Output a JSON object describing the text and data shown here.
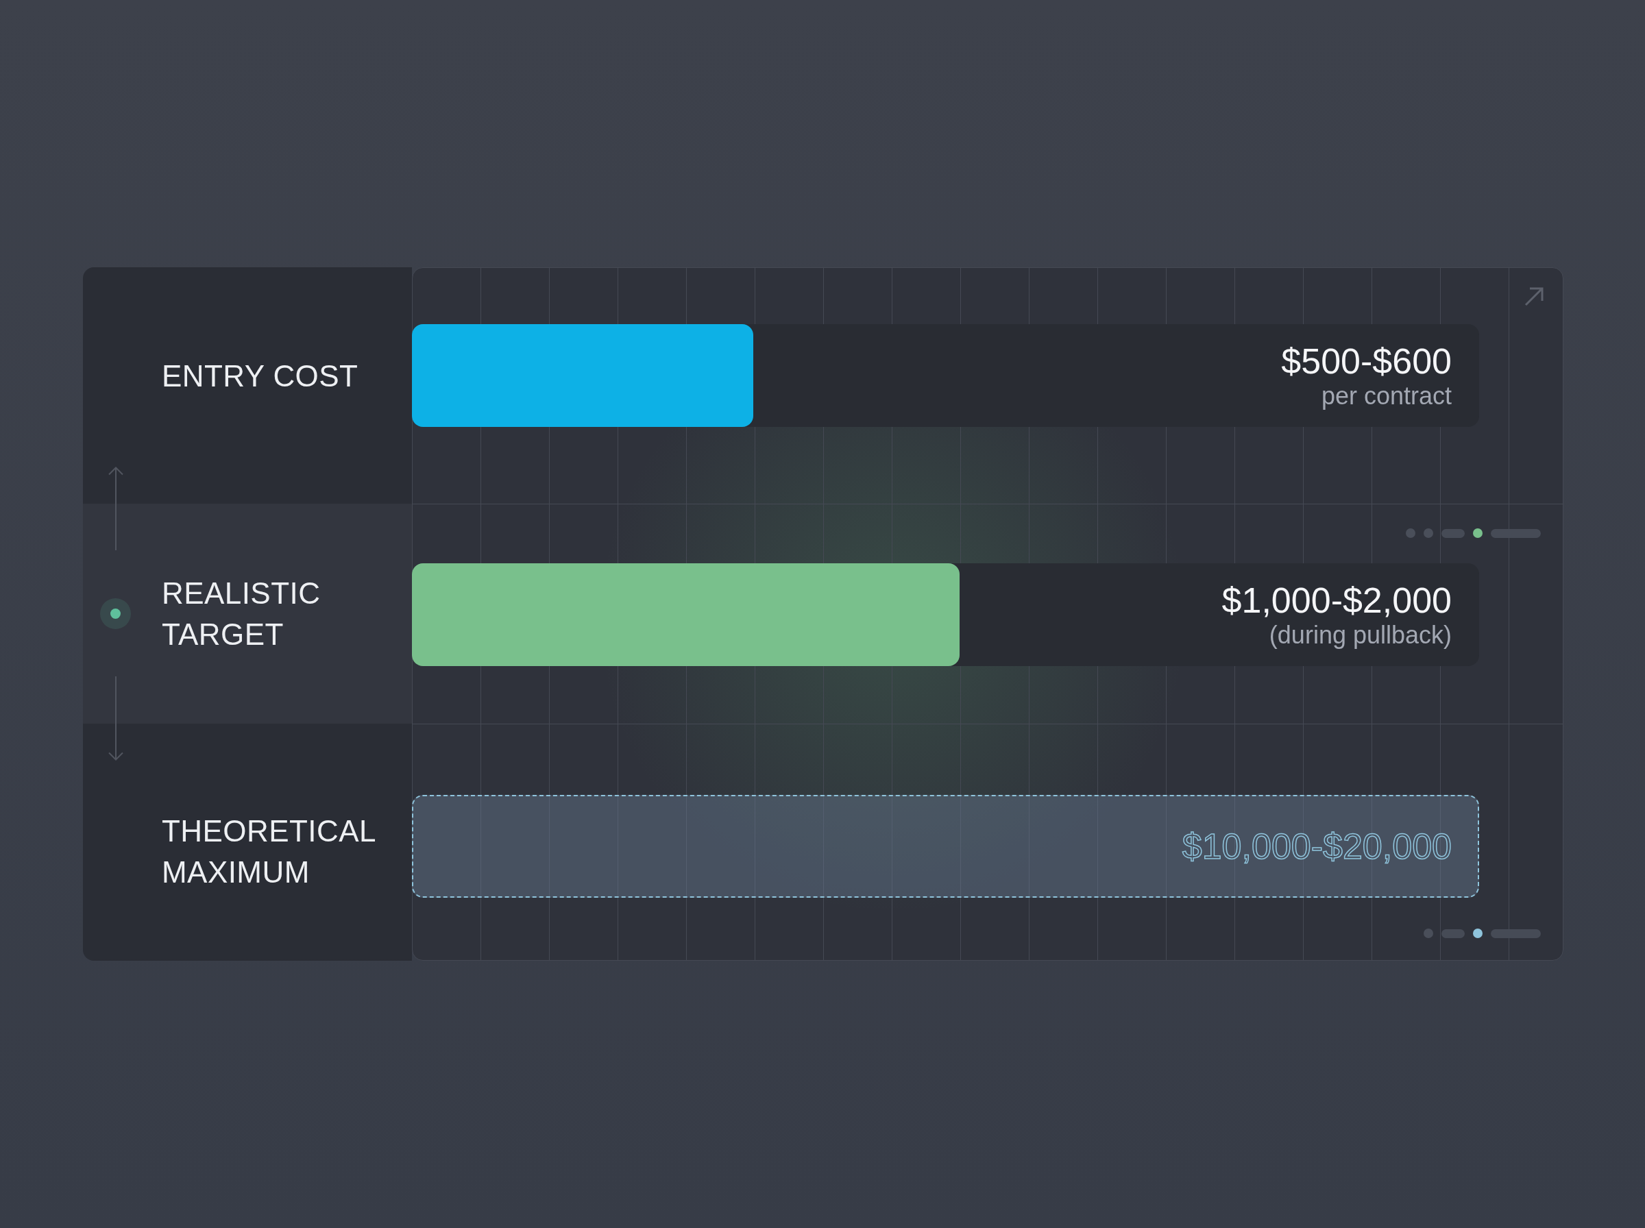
{
  "rows": [
    {
      "label": "ENTRY COST",
      "selected": false,
      "kind": "filled",
      "color": "#0db1e6",
      "level": 0.32,
      "value": "$500-$600",
      "note": "per contract"
    },
    {
      "label": "REALISTIC TARGET",
      "selected": true,
      "kind": "filled",
      "color": "#79c08c",
      "level": 0.513,
      "value": "$1,000-$2,000",
      "note": "(during pullback)",
      "indicator": [
        {
          "kind": "dot",
          "selected": false
        },
        {
          "kind": "dot",
          "selected": false
        },
        {
          "kind": "dash",
          "selected": false
        },
        {
          "kind": "dot",
          "selected": true
        },
        {
          "kind": "long_dash",
          "selected": false
        }
      ]
    },
    {
      "label": "THEORETICAL MAXIMUM",
      "selected": false,
      "kind": "dashed",
      "color": "#8fc4dc",
      "value": "$10,000-$20,000",
      "indicator": [
        {
          "kind": "dot",
          "selected": false
        },
        {
          "kind": "dash",
          "selected": false
        },
        {
          "kind": "dot",
          "selected": true
        },
        {
          "kind": "long_dash",
          "selected": false
        }
      ]
    }
  ]
}
